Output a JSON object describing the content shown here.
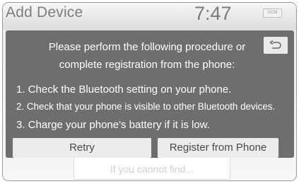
{
  "header": {
    "title": "Add Device",
    "clock": "7:47",
    "badge": "DCM"
  },
  "dialog": {
    "message_line1": "Please perform the following procedure or",
    "message_line2": "complete registration from the phone:",
    "steps": [
      "1. Check the Bluetooth setting on your phone.",
      "2. Check that your phone is visible to other Bluetooth devices.",
      "3. Charge your phone's battery if it is low."
    ],
    "retry_label": "Retry",
    "register_label": "Register from Phone"
  },
  "background": {
    "hint_button_label": "If you cannot find..."
  }
}
